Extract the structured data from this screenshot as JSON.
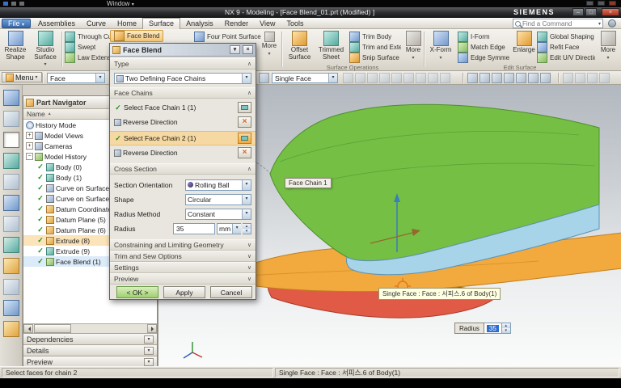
{
  "window": {
    "top_window_menu": "Window",
    "title": "NX 9 - Modeling - [Face Blend_01.prt (Modified) ]",
    "brand": "SIEMENS"
  },
  "menubar": {
    "file": "File",
    "items": [
      "Assemblies",
      "Curve",
      "Home",
      "Surface",
      "Analysis",
      "Render",
      "View",
      "Tools"
    ],
    "active": "Surface",
    "find_placeholder": "Find a Command"
  },
  "ribbon": {
    "realize_shape": "Realize Shape",
    "studio_surface": "Studio Surface",
    "through_curves": "Through Curves",
    "swept": "Swept",
    "law_extension": "Law Extension",
    "face_blend": "Face Blend",
    "four_point_surface": "Four Point Surface",
    "more_a": "More",
    "offset_surface": "Offset Surface",
    "trimmed_sheet": "Trimmed Sheet",
    "trim_body": "Trim Body",
    "trim_and_extend": "Trim and Extend",
    "snip_surface": "Snip Surface",
    "more_b": "More",
    "group_surface_operations": "Surface Operations",
    "x_form": "X-Form",
    "i_form": "I-Form",
    "match_edge": "Match Edge",
    "edge_symmetry": "Edge Symmetry",
    "enlarge": "Enlarge",
    "global_shaping": "Global Shaping",
    "refit_face": "Refit Face",
    "edit_uv_direction": "Edit U/V Direction",
    "more_c": "More",
    "group_edit_surface": "Edit Surface"
  },
  "selection_bar": {
    "menu_label": "Menu",
    "type_filter": "Face",
    "scope_filter": "Single Face"
  },
  "part_navigator": {
    "title": "Part Navigator",
    "name_header": "Name",
    "items": [
      {
        "label": "History Mode"
      },
      {
        "label": "Model Views"
      },
      {
        "label": "Cameras"
      },
      {
        "label": "Model History"
      },
      {
        "label": "Body (0)"
      },
      {
        "label": "Body (1)"
      },
      {
        "label": "Curve on Surface ("
      },
      {
        "label": "Curve on Surface ("
      },
      {
        "label": "Datum Coordinate"
      },
      {
        "label": "Datum Plane (5)"
      },
      {
        "label": "Datum Plane (6)"
      },
      {
        "label": "Extrude (8)"
      },
      {
        "label": "Extrude (9)"
      },
      {
        "label": "Face Blend (1)"
      }
    ],
    "panels": [
      "Dependencies",
      "Details",
      "Preview"
    ]
  },
  "dialog": {
    "title": "Face Blend",
    "type_section": "Type",
    "type_value": "Two Defining Face Chains",
    "face_chains_section": "Face Chains",
    "select_chain1": "Select Face Chain 1 (1)",
    "reverse_direction1": "Reverse Direction",
    "select_chain2": "Select Face Chain 2 (1)",
    "reverse_direction2": "Reverse Direction",
    "cross_section": "Cross Section",
    "section_orientation_label": "Section Orientation",
    "section_orientation_value": "Rolling Ball",
    "shape_label": "Shape",
    "shape_value": "Circular",
    "radius_method_label": "Radius Method",
    "radius_method_value": "Constant",
    "radius_label": "Radius",
    "radius_value": "35",
    "radius_unit": "mm",
    "collapsed_sections": [
      "Constraining and Limiting Geometry",
      "Trim and Sew Options",
      "Settings",
      "Preview"
    ],
    "ok": "< OK >",
    "apply": "Apply",
    "cancel": "Cancel"
  },
  "viewport": {
    "face_chain_tag": "Face Chain 1",
    "tooltip": "Single Face : Face : 서피스.6 of Body(1)",
    "radius_label": "Radius",
    "radius_value": "35"
  },
  "statusbar": {
    "prompt": "Select faces for chain 2",
    "selection_info": "Single Face : Face : 서피스.6 of Body(1)"
  },
  "colors": {
    "surface_green": "#74bf44",
    "surface_blue": "#a8d4ea",
    "surface_orange": "#f2a93d",
    "surface_red": "#e05a46",
    "selection_highlight": "#f4c06a",
    "ok_button": "#a8d477"
  }
}
